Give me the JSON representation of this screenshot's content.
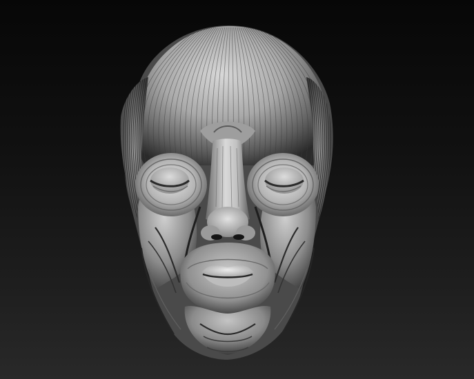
{
  "scene": {
    "subject": "ecorche-head-sculpt",
    "colors": {
      "background_top": "#070707",
      "background_bottom": "#292929",
      "material_light": "#e6e6e6",
      "material_mid": "#8a8a8a",
      "material_dark": "#1c1c1c"
    }
  }
}
